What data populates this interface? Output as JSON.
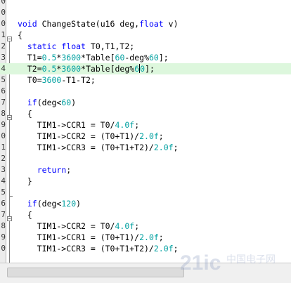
{
  "editor": {
    "lines": [
      {
        "ln": "0",
        "code": ""
      },
      {
        "ln": "0",
        "code": ""
      },
      {
        "ln": "0",
        "code": "void ChangeState(u16 deg,float v)"
      },
      {
        "ln": "1",
        "code": "{"
      },
      {
        "ln": "2",
        "code": "  static float T0,T1,T2;"
      },
      {
        "ln": "3",
        "code": "  T1=0.5*3600*Table[60-deg%60];"
      },
      {
        "ln": "4",
        "code": "  T2=0.5*3600*Table[deg%60];"
      },
      {
        "ln": "5",
        "code": "  T0=3600-T1-T2;"
      },
      {
        "ln": "6",
        "code": ""
      },
      {
        "ln": "7",
        "code": "  if(deg<60)"
      },
      {
        "ln": "8",
        "code": "  {"
      },
      {
        "ln": "9",
        "code": "    TIM1->CCR1 = T0/4.0f;"
      },
      {
        "ln": "0",
        "code": "    TIM1->CCR2 = (T0+T1)/2.0f;"
      },
      {
        "ln": "1",
        "code": "    TIM1->CCR3 = (T0+T1+T2)/2.0f;"
      },
      {
        "ln": "2",
        "code": ""
      },
      {
        "ln": "3",
        "code": "    return;"
      },
      {
        "ln": "4",
        "code": "  }"
      },
      {
        "ln": "5",
        "code": ""
      },
      {
        "ln": "6",
        "code": "  if(deg<120)"
      },
      {
        "ln": "7",
        "code": "  {"
      },
      {
        "ln": "8",
        "code": "    TIM1->CCR2 = T0/4.0f;"
      },
      {
        "ln": "9",
        "code": "    TIM1->CCR1 = (T0+T1)/2.0f;"
      },
      {
        "ln": "0",
        "code": "    TIM1->CCR3 = (T0+T1+T2)/2.0f;"
      }
    ],
    "highlighted_line_index": 6,
    "keywords": [
      "void",
      "float",
      "static",
      "if",
      "return"
    ],
    "colors": {
      "keyword": "#0000ff",
      "number": "#00a0a0",
      "highlight": "#ddf7dd"
    }
  },
  "watermark": {
    "text": "21ic 中国电子网",
    "icon": "21ic-logo"
  }
}
